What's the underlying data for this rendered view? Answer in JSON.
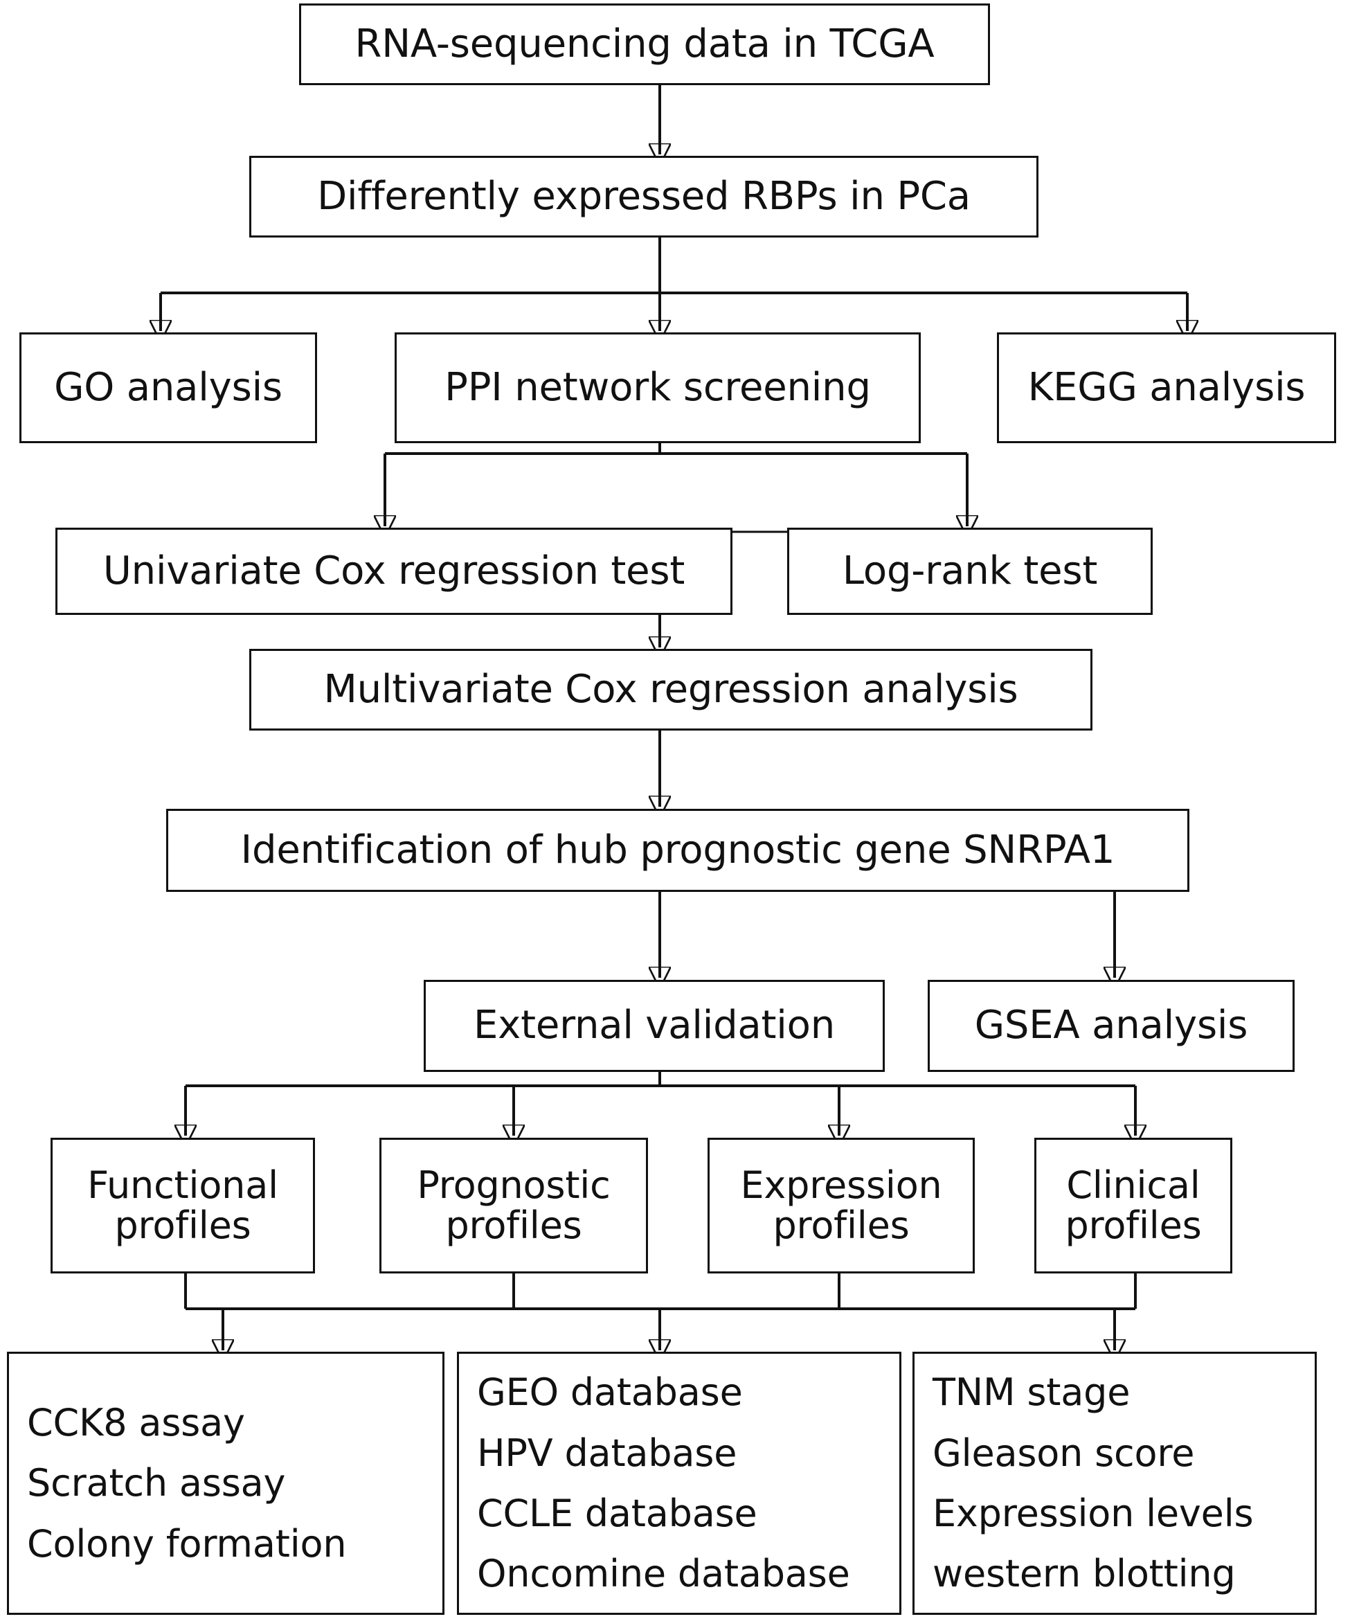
{
  "diagram": {
    "title": "Study workflow flowchart",
    "line_color": "#111111",
    "box_border_color": "#111111",
    "background_color": "#ffffff",
    "nodes": {
      "rna_seq": {
        "label": "RNA-sequencing data in TCGA"
      },
      "deg_rbp": {
        "label": "Differently expressed RBPs in PCa"
      },
      "go": {
        "label": "GO analysis"
      },
      "ppi": {
        "label": "PPI network screening"
      },
      "kegg": {
        "label": "KEGG analysis"
      },
      "univariate": {
        "label": "Univariate Cox regression test"
      },
      "logrank": {
        "label": "Log-rank test"
      },
      "multivariate": {
        "label": "Multivariate Cox regression analysis"
      },
      "hub_gene": {
        "label": "Identification of hub prognostic gene SNRPA1"
      },
      "external": {
        "label": "External validation"
      },
      "gsea": {
        "label": "GSEA analysis"
      },
      "functional": {
        "label": "Functional\nprofiles"
      },
      "prognostic": {
        "label": "Prognostic\nprofiles"
      },
      "expression": {
        "label": "Expression\nprofiles"
      },
      "clinical": {
        "label": "Clinical\nprofiles"
      },
      "assays": {
        "label": "CCK8 assay\nScratch assay\nColony formation"
      },
      "databases": {
        "label": "GEO database\nHPV database\nCCLE database\nOncomine database"
      },
      "clinical_items": {
        "label": "TNM stage\nGleason score\nExpression levels\nwestern blotting"
      }
    }
  }
}
